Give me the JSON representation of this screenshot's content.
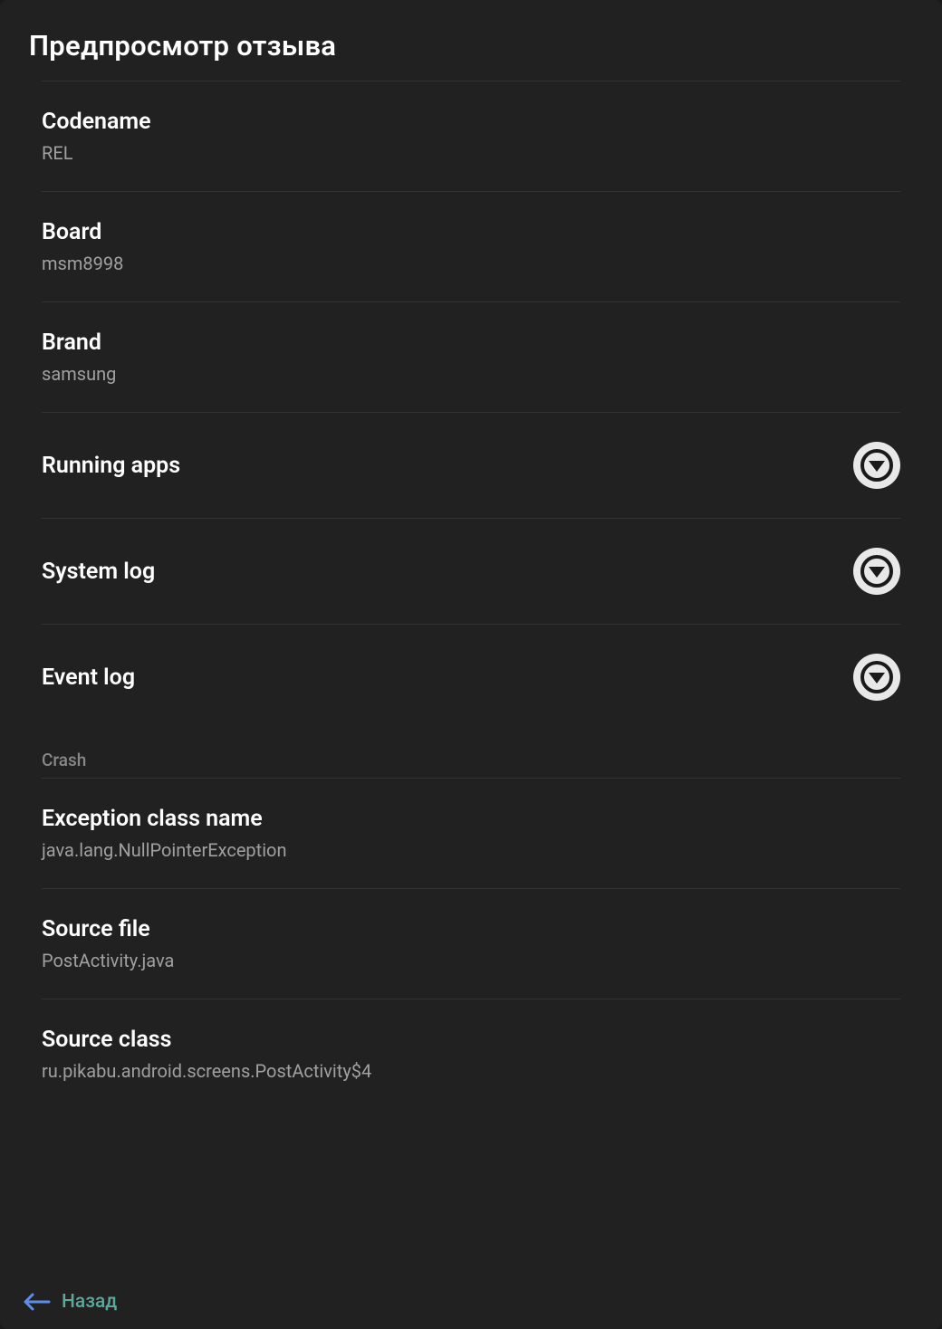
{
  "header": {
    "title": "Предпросмотр отзыва"
  },
  "items": [
    {
      "label": "Codename",
      "value": "REL"
    },
    {
      "label": "Board",
      "value": "msm8998"
    },
    {
      "label": "Brand",
      "value": "samsung"
    }
  ],
  "expandables": [
    {
      "label": "Running apps"
    },
    {
      "label": "System log"
    },
    {
      "label": "Event log"
    }
  ],
  "crash": {
    "section_label": "Crash",
    "items": [
      {
        "label": "Exception class name",
        "value": "java.lang.NullPointerException"
      },
      {
        "label": "Source file",
        "value": "PostActivity.java"
      },
      {
        "label": "Source class",
        "value": "ru.pikabu.android.screens.PostActivity$4"
      }
    ]
  },
  "footer": {
    "back_label": "Назад"
  }
}
